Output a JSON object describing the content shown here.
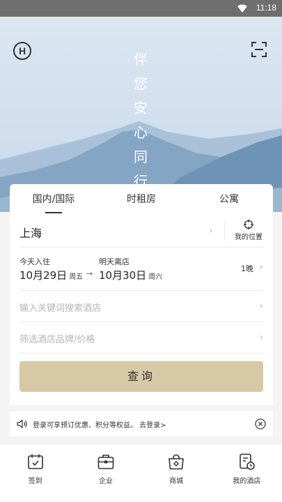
{
  "status_bar": {
    "time": "11:18",
    "wifi_icon": "wifi-icon"
  },
  "hero": {
    "logo_letter": "H",
    "slogan": [
      "伴",
      "您",
      "安",
      "心",
      "同",
      "行"
    ],
    "colors": {
      "sky": "#d3e0ee",
      "mountain_far": "#a9c1d8",
      "mountain_mid": "#84a5c3",
      "mountain_near": "#5f86ad"
    }
  },
  "tabs": [
    {
      "label": "国内/国际",
      "active": true
    },
    {
      "label": "时租房",
      "active": false
    },
    {
      "label": "公寓",
      "active": false
    }
  ],
  "search": {
    "city": "上海",
    "my_location": "我的位置",
    "checkin_label": "今天入住",
    "checkin_date": "10月29日",
    "checkin_weekday": "周五",
    "arrow": "→",
    "checkout_label": "明天离店",
    "checkout_date": "10月30日",
    "checkout_weekday": "周六",
    "nights": "1晚",
    "keyword_placeholder": "输入关键词搜索酒店",
    "brand_placeholder": "筛选酒店品牌/价格",
    "submit_label": "查询",
    "accent": "#d8c9a6"
  },
  "notice": {
    "text": "登录可享预订优惠、积分等权益。 去登录>"
  },
  "bottom_nav": [
    {
      "label": "签到",
      "icon": "calendar-check-icon"
    },
    {
      "label": "企业",
      "icon": "briefcase-icon"
    },
    {
      "label": "商城",
      "icon": "shopping-bag-icon"
    },
    {
      "label": "我的酒店",
      "icon": "my-hotel-icon"
    }
  ]
}
